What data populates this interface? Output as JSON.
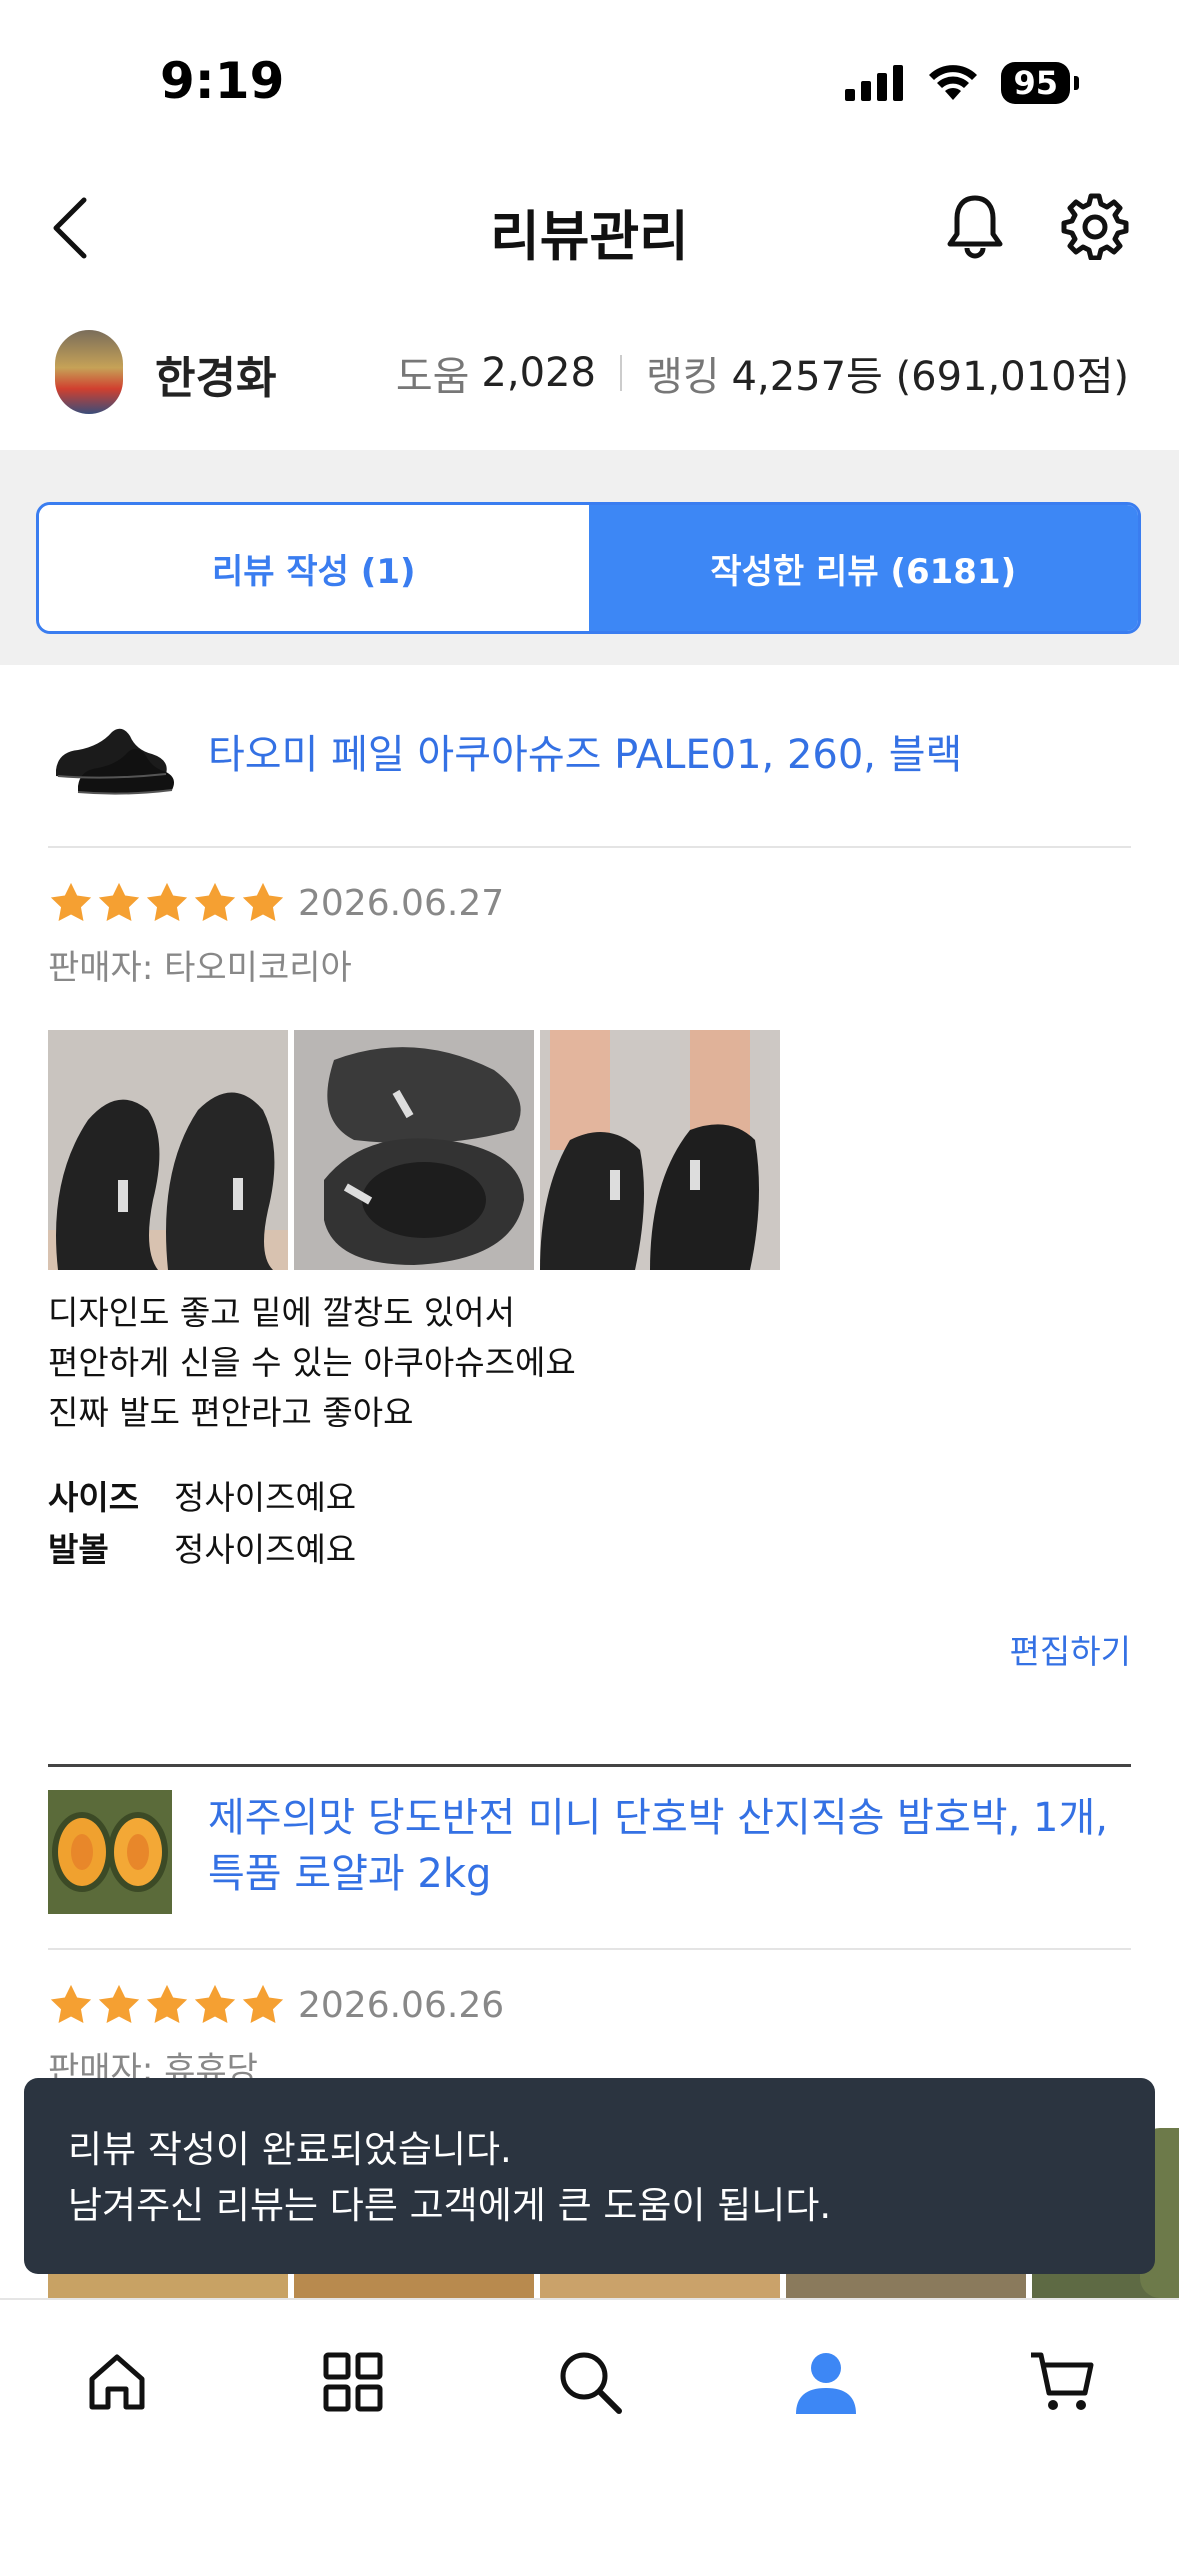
{
  "status_bar": {
    "time": "9:19",
    "battery": "95"
  },
  "header": {
    "title": "리뷰관리"
  },
  "profile": {
    "name": "한경화",
    "help_label": "도움",
    "help_value": "2,028",
    "rank_label": "랭킹",
    "rank_value": "4,257등 (691,010점)"
  },
  "tabs": [
    {
      "label": "리뷰 작성 (1)",
      "active": false
    },
    {
      "label": "작성한 리뷰 (6181)",
      "active": true
    }
  ],
  "reviews": [
    {
      "product": "타오미 페일 아쿠아슈즈 PALE01, 260, 블랙",
      "rating": 5,
      "date": "2026.06.27",
      "seller": "판매자: 타오미코리아",
      "text_lines": [
        "디자인도 좋고 밑에 깔창도 있어서",
        "편안하게 신을 수 있는 아쿠아슈즈에요",
        "진짜 발도 편안라고 좋아요"
      ],
      "attrs": [
        {
          "key": "사이즈",
          "value": "정사이즈예요"
        },
        {
          "key": "발볼",
          "value": "정사이즈예요"
        }
      ],
      "edit_label": "편집하기"
    },
    {
      "product": "제주의맛 당도반전 미니 단호박 산지직송 밤호박, 1개, 특품 로얄과 2kg",
      "rating": 5,
      "date": "2026.06.26",
      "seller": "판매자: 휴휴당"
    }
  ],
  "toast": {
    "line1": "리뷰 작성이 완료되었습니다.",
    "line2": "남겨주신 리뷰는 다른 고객에게 큰 도움이 됩니다."
  },
  "colors": {
    "accent": "#3d87f5",
    "link": "#3471e4",
    "star": "#f5a032",
    "toast_bg": "#2b3440"
  },
  "bottom_nav": [
    "home-icon",
    "category-icon",
    "search-icon",
    "profile-icon",
    "cart-icon"
  ]
}
